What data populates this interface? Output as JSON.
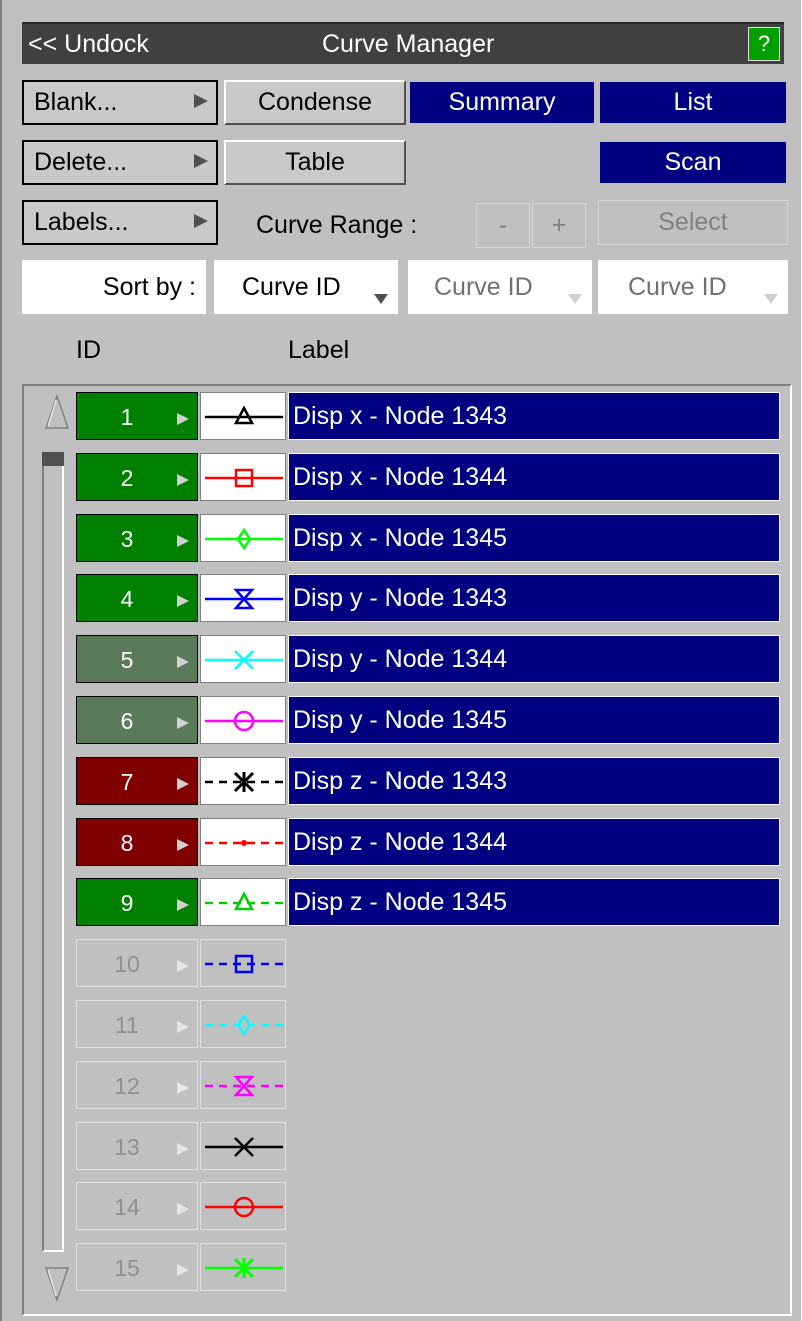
{
  "titlebar": {
    "undock": "<< Undock",
    "title": "Curve Manager",
    "help": "?"
  },
  "buttons": {
    "blank": "Blank...",
    "delete": "Delete...",
    "labels": "Labels...",
    "condense": "Condense",
    "table": "Table",
    "summary": "Summary",
    "list": "List",
    "scan": "Scan",
    "minus": "-",
    "plus": "+",
    "select": "Select"
  },
  "curve_range_label": "Curve Range :",
  "sort": {
    "label": "Sort by :",
    "key1": "Curve ID",
    "key2": "Curve ID",
    "key3": "Curve ID"
  },
  "columns": {
    "id": "ID",
    "label": "Label"
  },
  "colors": {
    "accent": "#000080",
    "green": "#008000",
    "greygreen": "#5a7a5a",
    "darkred": "#800000",
    "titlebar": "#404040"
  },
  "curves": [
    {
      "id": "1",
      "label": "Disp x - Node 1343",
      "state": "green",
      "color": "#000000",
      "dashed": false,
      "symbol": "triangle"
    },
    {
      "id": "2",
      "label": "Disp x - Node 1344",
      "state": "green",
      "color": "#ff0000",
      "dashed": false,
      "symbol": "square"
    },
    {
      "id": "3",
      "label": "Disp x - Node 1345",
      "state": "green",
      "color": "#00ff00",
      "dashed": false,
      "symbol": "diamond"
    },
    {
      "id": "4",
      "label": "Disp y - Node 1343",
      "state": "green",
      "color": "#0000ff",
      "dashed": false,
      "symbol": "hourglass"
    },
    {
      "id": "5",
      "label": "Disp y - Node 1344",
      "state": "greygreen",
      "color": "#00ffff",
      "dashed": false,
      "symbol": "x"
    },
    {
      "id": "6",
      "label": "Disp y - Node 1345",
      "state": "greygreen",
      "color": "#ff00ff",
      "dashed": false,
      "symbol": "circle"
    },
    {
      "id": "7",
      "label": "Disp z - Node 1343",
      "state": "darkred",
      "color": "#000000",
      "dashed": true,
      "symbol": "star"
    },
    {
      "id": "8",
      "label": "Disp z - Node 1344",
      "state": "darkred",
      "color": "#ff0000",
      "dashed": true,
      "symbol": "dot"
    },
    {
      "id": "9",
      "label": "Disp z - Node 1345",
      "state": "green",
      "color": "#00cc00",
      "dashed": true,
      "symbol": "triangle"
    },
    {
      "id": "10",
      "label": "",
      "state": "empty",
      "color": "#0000ff",
      "dashed": true,
      "symbol": "square"
    },
    {
      "id": "11",
      "label": "",
      "state": "empty",
      "color": "#00ffff",
      "dashed": true,
      "symbol": "diamond"
    },
    {
      "id": "12",
      "label": "",
      "state": "empty",
      "color": "#ff00ff",
      "dashed": true,
      "symbol": "hourglass"
    },
    {
      "id": "13",
      "label": "",
      "state": "empty",
      "color": "#000000",
      "dashed": false,
      "symbol": "x"
    },
    {
      "id": "14",
      "label": "",
      "state": "empty",
      "color": "#ff0000",
      "dashed": false,
      "symbol": "circle"
    },
    {
      "id": "15",
      "label": "",
      "state": "empty",
      "color": "#00ff00",
      "dashed": false,
      "symbol": "star"
    }
  ]
}
